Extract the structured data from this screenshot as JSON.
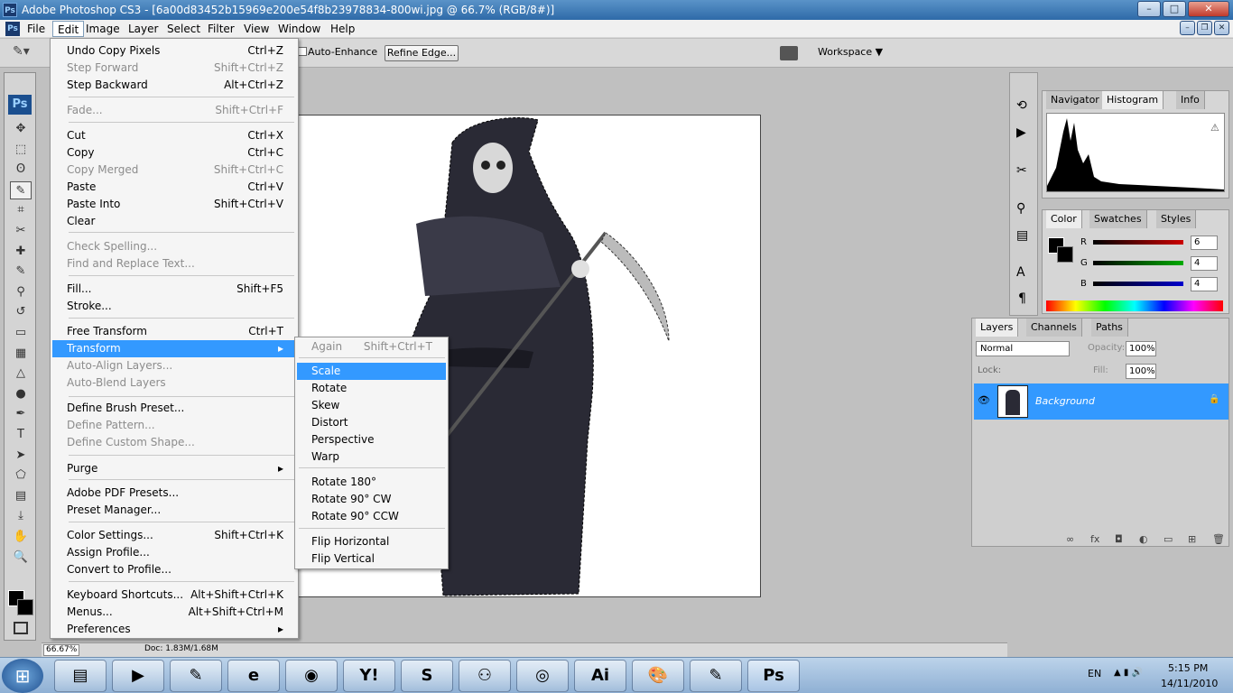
{
  "window": {
    "app_icon": "Ps",
    "title": "Adobe Photoshop CS3 - [6a00d83452b15969e200e54f8b23978834-800wi.jpg @ 66.7% (RGB/8#)]",
    "minimize_label": "–",
    "maximize_label": "□",
    "close_label": "✕",
    "doc_minimize_label": "–",
    "doc_restore_label": "❐",
    "doc_close_label": "✕"
  },
  "menubar": {
    "file": "File",
    "edit": "Edit",
    "image": "Image",
    "layer": "Layer",
    "select": "Select",
    "filter": "Filter",
    "view": "View",
    "window": "Window",
    "help": "Help"
  },
  "options": {
    "auto_enhance": "Auto-Enhance",
    "refine_edge": "Refine Edge...",
    "workspace": "Workspace ▼"
  },
  "edit_menu": [
    {
      "label": "Undo Copy Pixels",
      "shortcut": "Ctrl+Z",
      "disabled": false
    },
    {
      "label": "Step Forward",
      "shortcut": "Shift+Ctrl+Z",
      "disabled": true
    },
    {
      "label": "Step Backward",
      "shortcut": "Alt+Ctrl+Z",
      "disabled": false
    },
    {
      "label": "Fade...",
      "shortcut": "Shift+Ctrl+F",
      "disabled": true
    },
    {
      "label": "Cut",
      "shortcut": "Ctrl+X",
      "disabled": false
    },
    {
      "label": "Copy",
      "shortcut": "Ctrl+C",
      "disabled": false
    },
    {
      "label": "Copy Merged",
      "shortcut": "Shift+Ctrl+C",
      "disabled": true
    },
    {
      "label": "Paste",
      "shortcut": "Ctrl+V",
      "disabled": false
    },
    {
      "label": "Paste Into",
      "shortcut": "Shift+Ctrl+V",
      "disabled": false
    },
    {
      "label": "Clear",
      "shortcut": "",
      "disabled": false
    },
    {
      "label": "Check Spelling...",
      "shortcut": "",
      "disabled": true
    },
    {
      "label": "Find and Replace Text...",
      "shortcut": "",
      "disabled": true
    },
    {
      "label": "Fill...",
      "shortcut": "Shift+F5",
      "disabled": false
    },
    {
      "label": "Stroke...",
      "shortcut": "",
      "disabled": false
    },
    {
      "label": "Free Transform",
      "shortcut": "Ctrl+T",
      "disabled": false
    },
    {
      "label": "Transform",
      "shortcut": "▸",
      "disabled": false,
      "selected": true
    },
    {
      "label": "Auto-Align Layers...",
      "shortcut": "",
      "disabled": true
    },
    {
      "label": "Auto-Blend Layers",
      "shortcut": "",
      "disabled": true
    },
    {
      "label": "Define Brush Preset...",
      "shortcut": "",
      "disabled": false
    },
    {
      "label": "Define Pattern...",
      "shortcut": "",
      "disabled": true
    },
    {
      "label": "Define Custom Shape...",
      "shortcut": "",
      "disabled": true
    },
    {
      "label": "Purge",
      "shortcut": "▸",
      "disabled": false
    },
    {
      "label": "Adobe PDF Presets...",
      "shortcut": "",
      "disabled": false
    },
    {
      "label": "Preset Manager...",
      "shortcut": "",
      "disabled": false
    },
    {
      "label": "Color Settings...",
      "shortcut": "Shift+Ctrl+K",
      "disabled": false
    },
    {
      "label": "Assign Profile...",
      "shortcut": "",
      "disabled": false
    },
    {
      "label": "Convert to Profile...",
      "shortcut": "",
      "disabled": false
    },
    {
      "label": "Keyboard Shortcuts...",
      "shortcut": "Alt+Shift+Ctrl+K",
      "disabled": false
    },
    {
      "label": "Menus...",
      "shortcut": "Alt+Shift+Ctrl+M",
      "disabled": false
    },
    {
      "label": "Preferences",
      "shortcut": "▸",
      "disabled": false
    }
  ],
  "transform_menu": [
    {
      "label": "Again",
      "shortcut": "Shift+Ctrl+T",
      "disabled": true
    },
    {
      "label": "Scale",
      "shortcut": "",
      "disabled": false,
      "selected": true
    },
    {
      "label": "Rotate",
      "shortcut": "",
      "disabled": false
    },
    {
      "label": "Skew",
      "shortcut": "",
      "disabled": false
    },
    {
      "label": "Distort",
      "shortcut": "",
      "disabled": false
    },
    {
      "label": "Perspective",
      "shortcut": "",
      "disabled": false
    },
    {
      "label": "Warp",
      "shortcut": "",
      "disabled": false
    },
    {
      "label": "Rotate 180°",
      "shortcut": "",
      "disabled": false
    },
    {
      "label": "Rotate 90° CW",
      "shortcut": "",
      "disabled": false
    },
    {
      "label": "Rotate 90° CCW",
      "shortcut": "",
      "disabled": false
    },
    {
      "label": "Flip Horizontal",
      "shortcut": "",
      "disabled": false
    },
    {
      "label": "Flip Vertical",
      "shortcut": "",
      "disabled": false
    }
  ],
  "toolbox": {
    "logo": "Ps",
    "tools": [
      "move-icon",
      "marquee-icon",
      "lasso-icon",
      "quick-selection-icon",
      "crop-icon",
      "slice-icon",
      "healing-brush-icon",
      "brush-icon",
      "clone-stamp-icon",
      "history-brush-icon",
      "eraser-icon",
      "gradient-icon",
      "blur-icon",
      "dodge-icon",
      "pen-icon",
      "type-icon",
      "path-selection-icon",
      "shape-icon",
      "notes-icon",
      "eyedropper-icon",
      "hand-icon",
      "zoom-icon"
    ],
    "glyphs": [
      "✥",
      "⬚",
      "ʘ",
      "✎",
      "⌗",
      "✂",
      "✚",
      "✎",
      "⚲",
      "↺",
      "▭",
      "▦",
      "△",
      "●",
      "✒",
      "T",
      "➤",
      "⬠",
      "▤",
      "⤓",
      "✋",
      "🔍"
    ]
  },
  "histogram_panel": {
    "tabs": [
      "Navigator",
      "Histogram",
      "Info"
    ],
    "active_tab": "Histogram",
    "warning_glyph": "⚠"
  },
  "color_panel": {
    "tabs": [
      "Color",
      "Swatches",
      "Styles"
    ],
    "active_tab": "Color",
    "channels": [
      {
        "name": "R",
        "value": "6",
        "color": "#cc0000"
      },
      {
        "name": "G",
        "value": "4",
        "color": "#00aa00"
      },
      {
        "name": "B",
        "value": "4",
        "color": "#0000cc"
      }
    ]
  },
  "layers_panel": {
    "tabs": [
      "Layers",
      "Channels",
      "Paths"
    ],
    "active_tab": "Layers",
    "blend_mode": "Normal",
    "opacity_label": "Opacity:",
    "opacity": "100%",
    "lock_label": "Lock:",
    "fill_label": "Fill:",
    "fill": "100%",
    "layers": [
      {
        "name": "Background",
        "visible": true,
        "locked": true
      }
    ],
    "bottom_icons": [
      "∞",
      "fx",
      "◘",
      "◐",
      "▭",
      "⊞",
      "🗑"
    ]
  },
  "status": {
    "zoom": "66.67%",
    "doc_info": "Doc: 1.83M/1.68M"
  },
  "taskbar": {
    "start": "⊞",
    "apps": [
      "explorer-icon",
      "media-player-icon",
      "paint-tools-icon",
      "ie-icon",
      "chrome-icon",
      "yahoo-messenger-icon",
      "skype-icon",
      "network-icon",
      "vodafone-icon",
      "illustrator-icon",
      "paint-icon",
      "notepad-icon",
      "photoshop-icon"
    ],
    "app_glyphs": [
      "▤",
      "▶",
      "✎",
      "e",
      "◉",
      "Y!",
      "S",
      "⚇",
      "◎",
      "Ai",
      "🎨",
      "✎",
      "Ps"
    ],
    "lang": "EN",
    "time": "5:15 PM",
    "date": "14/11/2010"
  },
  "colors": {
    "selection": "#3399ff",
    "titlebar": "#2e6aa8"
  }
}
